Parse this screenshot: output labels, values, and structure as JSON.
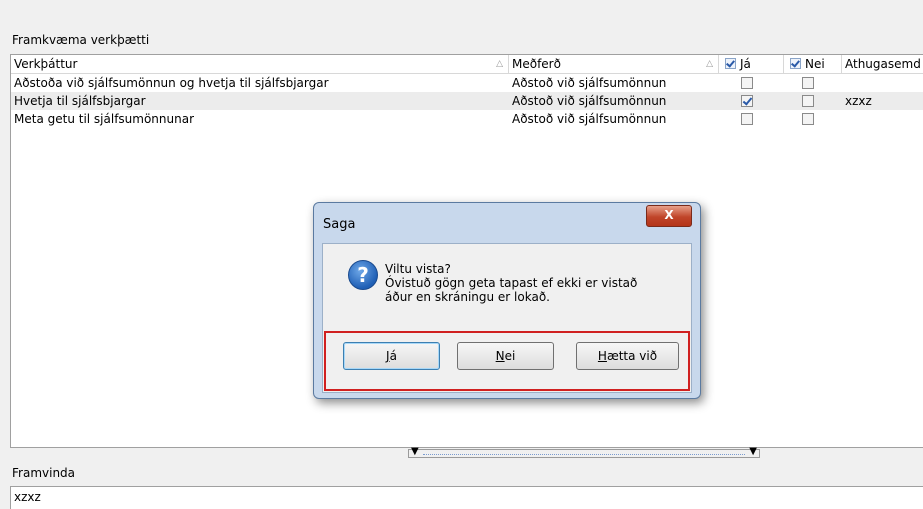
{
  "sections": {
    "tasks_title": "Framkvæma verkþætti",
    "progress_title": "Framvinda"
  },
  "grid": {
    "columns": [
      {
        "label": "Verkþáttur",
        "sortable": true
      },
      {
        "label": "Meðferð",
        "sortable": true
      },
      {
        "label": "Já",
        "checkbox": true
      },
      {
        "label": "Nei",
        "checkbox": true
      },
      {
        "label": "Athugasemd"
      }
    ],
    "rows": [
      {
        "task": "Aðstoða við sjálfsumönnun og hvetja til sjálfsbjargar",
        "treatment": "Aðstoð við sjálfsumönnun",
        "yes": false,
        "no": false,
        "note": ""
      },
      {
        "task": "Hvetja til sjálfsbjargar",
        "treatment": "Aðstoð við sjálfsumönnun",
        "yes": true,
        "no": false,
        "note": "xzxz"
      },
      {
        "task": "Meta getu til sjálfsumönnunar",
        "treatment": "Aðstoð við sjálfsumönnun",
        "yes": false,
        "no": false,
        "note": ""
      }
    ]
  },
  "progress_text": "xzxz",
  "dialog": {
    "title": "Saga",
    "close_label": "X",
    "icon": "question-icon",
    "message_line1": "Viltu vista?",
    "message_line2": "Óvistuð gögn geta tapast ef ekki er vistað",
    "message_line3": "áður en skráningu er lokað.",
    "buttons": {
      "yes_u": "J",
      "yes_rest": "á",
      "no_u": "N",
      "no_rest": "ei",
      "cancel_u": "H",
      "cancel_rest": "ætta við"
    }
  },
  "colors": {
    "highlight_border": "#d02020",
    "checkbox_check": "#2a5aa8"
  }
}
